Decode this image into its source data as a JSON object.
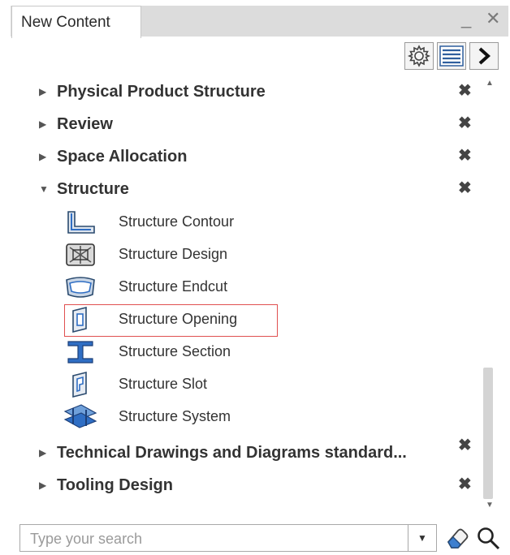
{
  "tab": {
    "title": "New Content"
  },
  "window": {
    "minimize": "_",
    "close": "✕"
  },
  "toolbar": {
    "settings": "settings",
    "list": "list-view",
    "expand": "expand"
  },
  "categories_top": [
    {
      "label": "Physical Product Structure",
      "arrow": "▶"
    },
    {
      "label": "Review",
      "arrow": "▶"
    },
    {
      "label": "Space Allocation",
      "arrow": "▶"
    },
    {
      "label": "Structure",
      "arrow": "▼"
    }
  ],
  "structure_items": [
    {
      "label": "Structure Contour",
      "icon": "structure-contour-icon"
    },
    {
      "label": "Structure Design",
      "icon": "structure-design-icon"
    },
    {
      "label": "Structure Endcut",
      "icon": "structure-endcut-icon"
    },
    {
      "label": "Structure Opening",
      "icon": "structure-opening-icon",
      "highlighted": true
    },
    {
      "label": "Structure Section",
      "icon": "structure-section-icon"
    },
    {
      "label": "Structure Slot",
      "icon": "structure-slot-icon"
    },
    {
      "label": "Structure System",
      "icon": "structure-system-icon"
    }
  ],
  "categories_bottom": [
    {
      "label": "Technical Drawings and Diagrams standard...",
      "arrow": "▶"
    },
    {
      "label": "Tooling Design",
      "arrow": "▶"
    }
  ],
  "remove_glyph": "✖",
  "search": {
    "placeholder": "Type your search",
    "value": ""
  },
  "colors": {
    "accent_blue": "#2f6ec4",
    "highlight_border": "#e05050"
  }
}
